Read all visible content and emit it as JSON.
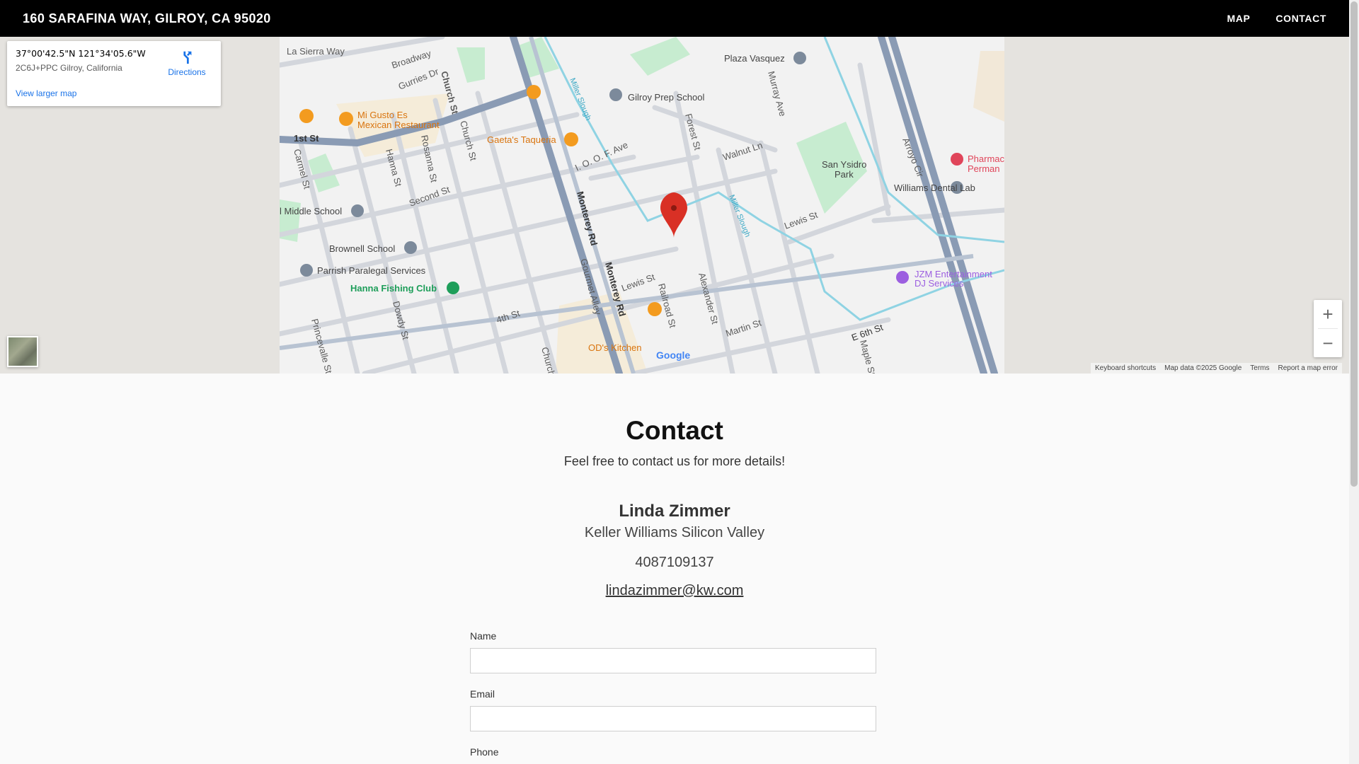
{
  "header": {
    "title": "160 SARAFINA WAY, GILROY, CA 95020",
    "nav": [
      "MAP",
      "CONTACT"
    ]
  },
  "map": {
    "info_card": {
      "coordinates": "37°00'42.5\"N 121°34'05.6\"W",
      "plus_code": "2C6J+PPC Gilroy, California",
      "directions_label": "Directions",
      "larger_map_label": "View larger map"
    },
    "zoom": {
      "in": "+",
      "out": "−"
    },
    "attribution": [
      "Keyboard shortcuts",
      "Map data ©2025 Google",
      "Terms",
      "Report a map error"
    ],
    "google_logo": "Google",
    "street_labels": [
      "La Sierra Way",
      "Broadway",
      "Gurries Dr",
      "Church St",
      "Church St",
      "Miller Slough",
      "Plaza Vasquez",
      "Gilroy Prep School",
      "Forest St",
      "Murray Ave",
      "Arroyo Cir",
      "1st St",
      "Carmel St",
      "Hanna St",
      "Rosanna St",
      "Second St",
      "I. O. O. F. Ave",
      "Walnut Ln",
      "San Ysidro Park",
      "Williams Dental Lab",
      "Middle School",
      "Monterey Rd",
      "Lewis St",
      "Miller Slough",
      "Brownell School",
      "Parrish Paralegal Services",
      "Hanna Fishing Club",
      "Dowdy St",
      "Princevalle St",
      "4th St",
      "Church St",
      "Gourmet Alley",
      "Monterey Rd",
      "Lewis St",
      "Railroad St",
      "Alexander St",
      "Martin St",
      "E 6th St",
      "Maple St",
      "JZM Entertainment",
      "DJ Services",
      "Mi Gusto Es",
      "Mexican Restaurant",
      "Gaeta's Taqueria",
      "OD's Kitchen",
      "Pharmac",
      "Perman"
    ],
    "colors": {
      "road_major": "#8a9bb4",
      "water": "#8fd3e3",
      "park": "#c7ecd0",
      "poi_orange": "#f39b1f",
      "poi_gray": "#7c8a9b",
      "pin": "#d93025"
    }
  },
  "contact": {
    "title": "Contact",
    "subtitle": "Feel free to contact us for more details!",
    "agent_name": "Linda Zimmer",
    "company": "Keller Williams Silicon Valley",
    "phone": "4087109137",
    "email": "lindazimmer@kw.com",
    "form": {
      "name_label": "Name",
      "name_value": "",
      "email_label": "Email",
      "email_value": "",
      "phone_label": "Phone"
    }
  }
}
